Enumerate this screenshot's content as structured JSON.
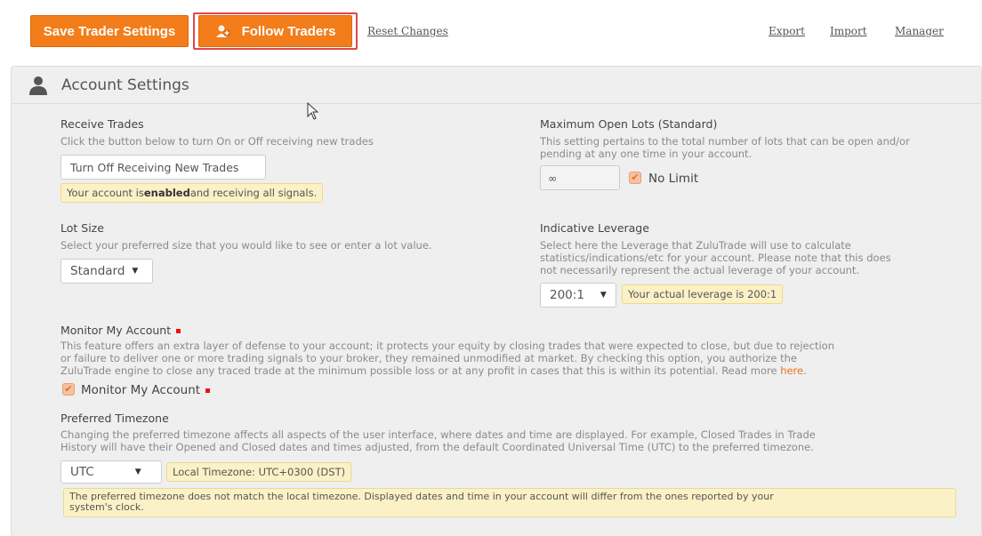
{
  "toolbar": {
    "save_label": "Save Trader Settings",
    "follow_label": "Follow Traders",
    "reset_label": "Reset Changes",
    "export_label": "Export",
    "import_label": "Import",
    "manager_label": "Manager"
  },
  "panel": {
    "title": "Account Settings"
  },
  "receive": {
    "label": "Receive Trades",
    "desc": "Click the button below to turn On or Off receiving new trades",
    "button": "Turn Off Receiving New Trades",
    "note_pre": "Your account is ",
    "note_bold": "enabled",
    "note_post": " and receiving all signals."
  },
  "maxlots": {
    "label": "Maximum Open Lots (Standard)",
    "desc1": "This setting pertains to the total number of lots that can be open and/or",
    "desc2": "pending at any one time in your account.",
    "value": "∞",
    "nolimit": "No Limit",
    "nolimit_checked": true
  },
  "lotsize": {
    "label": "Lot Size",
    "desc": "Select your preferred size that you would like to see or enter a lot value.",
    "selected": "Standard"
  },
  "leverage": {
    "label": "Indicative Leverage",
    "desc1": "Select here the Leverage that ZuluTrade will use to calculate",
    "desc2": "statistics/indications/etc for your account. Please note that this does",
    "desc3": "not necessarily represent the actual leverage of your account.",
    "selected": "200:1",
    "note": "Your actual leverage is 200:1"
  },
  "monitor": {
    "label": "Monitor My Account",
    "desc1": "This feature offers an extra layer of defense to your account; it protects your equity by closing trades that were expected to close, but due to rejection",
    "desc2": "or failure to deliver one or more trading signals to your broker, they remained unmodified at market. By checking this option, you authorize the",
    "desc3": "ZuluTrade engine to close any traced trade at the minimum possible loss or at any profit in cases that this is within its potential. Read more ",
    "here": "here",
    "desc3_end": ".",
    "checkbox_label": "Monitor My Account",
    "checked": true
  },
  "timezone": {
    "label": "Preferred Timezone",
    "desc1": "Changing the preferred timezone affects all aspects of the user interface, where dates and time are displayed. For example, Closed Trades in Trade",
    "desc2": "History will have their Opened and Closed dates and times adjusted, from the default Coordinated Universal Time (UTC) to the preferred timezone.",
    "selected": "UTC",
    "local": "Local Timezone: UTC+0300 (DST)",
    "warn1": "The preferred timezone does not match the local timezone. Displayed dates and time in your account will differ from the ones reported by your",
    "warn2": "system's clock."
  },
  "colors": {
    "accent": "#f27d1a",
    "highlight": "#e0474c",
    "note_bg": "#fbf1c6"
  }
}
